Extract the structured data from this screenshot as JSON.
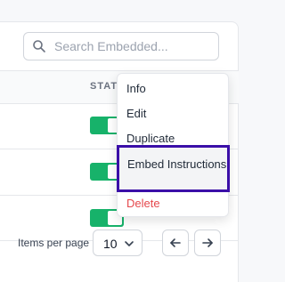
{
  "search": {
    "placeholder": "Search Embedded...",
    "value": ""
  },
  "table": {
    "columns": {
      "status": "STATUS"
    },
    "rows": [
      {
        "status": "on"
      },
      {
        "status": "on"
      },
      {
        "status": "on"
      }
    ]
  },
  "menu": {
    "items": {
      "info": "Info",
      "edit": "Edit",
      "duplicate": "Duplicate",
      "embed": "Embed Instructions",
      "delete": "Delete"
    }
  },
  "footer": {
    "items_per_page_label": "Items per page",
    "page_size": "10"
  },
  "colors": {
    "toggle_on": "#17b26a",
    "focus_ring": "#3b0fa8",
    "danger": "#e5484d"
  },
  "icons": {
    "search": "search-icon",
    "chevron": "chevron-down-icon",
    "prev": "arrow-left-icon",
    "next": "arrow-right-icon"
  }
}
